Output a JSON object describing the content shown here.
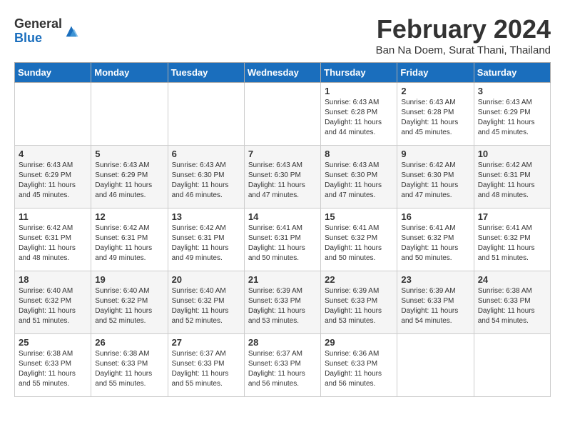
{
  "logo": {
    "general": "General",
    "blue": "Blue"
  },
  "header": {
    "month": "February 2024",
    "location": "Ban Na Doem, Surat Thani, Thailand"
  },
  "weekdays": [
    "Sunday",
    "Monday",
    "Tuesday",
    "Wednesday",
    "Thursday",
    "Friday",
    "Saturday"
  ],
  "weeks": [
    [
      {
        "day": "",
        "info": ""
      },
      {
        "day": "",
        "info": ""
      },
      {
        "day": "",
        "info": ""
      },
      {
        "day": "",
        "info": ""
      },
      {
        "day": "1",
        "info": "Sunrise: 6:43 AM\nSunset: 6:28 PM\nDaylight: 11 hours\nand 44 minutes."
      },
      {
        "day": "2",
        "info": "Sunrise: 6:43 AM\nSunset: 6:28 PM\nDaylight: 11 hours\nand 45 minutes."
      },
      {
        "day": "3",
        "info": "Sunrise: 6:43 AM\nSunset: 6:29 PM\nDaylight: 11 hours\nand 45 minutes."
      }
    ],
    [
      {
        "day": "4",
        "info": "Sunrise: 6:43 AM\nSunset: 6:29 PM\nDaylight: 11 hours\nand 45 minutes."
      },
      {
        "day": "5",
        "info": "Sunrise: 6:43 AM\nSunset: 6:29 PM\nDaylight: 11 hours\nand 46 minutes."
      },
      {
        "day": "6",
        "info": "Sunrise: 6:43 AM\nSunset: 6:30 PM\nDaylight: 11 hours\nand 46 minutes."
      },
      {
        "day": "7",
        "info": "Sunrise: 6:43 AM\nSunset: 6:30 PM\nDaylight: 11 hours\nand 47 minutes."
      },
      {
        "day": "8",
        "info": "Sunrise: 6:43 AM\nSunset: 6:30 PM\nDaylight: 11 hours\nand 47 minutes."
      },
      {
        "day": "9",
        "info": "Sunrise: 6:42 AM\nSunset: 6:30 PM\nDaylight: 11 hours\nand 47 minutes."
      },
      {
        "day": "10",
        "info": "Sunrise: 6:42 AM\nSunset: 6:31 PM\nDaylight: 11 hours\nand 48 minutes."
      }
    ],
    [
      {
        "day": "11",
        "info": "Sunrise: 6:42 AM\nSunset: 6:31 PM\nDaylight: 11 hours\nand 48 minutes."
      },
      {
        "day": "12",
        "info": "Sunrise: 6:42 AM\nSunset: 6:31 PM\nDaylight: 11 hours\nand 49 minutes."
      },
      {
        "day": "13",
        "info": "Sunrise: 6:42 AM\nSunset: 6:31 PM\nDaylight: 11 hours\nand 49 minutes."
      },
      {
        "day": "14",
        "info": "Sunrise: 6:41 AM\nSunset: 6:31 PM\nDaylight: 11 hours\nand 50 minutes."
      },
      {
        "day": "15",
        "info": "Sunrise: 6:41 AM\nSunset: 6:32 PM\nDaylight: 11 hours\nand 50 minutes."
      },
      {
        "day": "16",
        "info": "Sunrise: 6:41 AM\nSunset: 6:32 PM\nDaylight: 11 hours\nand 50 minutes."
      },
      {
        "day": "17",
        "info": "Sunrise: 6:41 AM\nSunset: 6:32 PM\nDaylight: 11 hours\nand 51 minutes."
      }
    ],
    [
      {
        "day": "18",
        "info": "Sunrise: 6:40 AM\nSunset: 6:32 PM\nDaylight: 11 hours\nand 51 minutes."
      },
      {
        "day": "19",
        "info": "Sunrise: 6:40 AM\nSunset: 6:32 PM\nDaylight: 11 hours\nand 52 minutes."
      },
      {
        "day": "20",
        "info": "Sunrise: 6:40 AM\nSunset: 6:32 PM\nDaylight: 11 hours\nand 52 minutes."
      },
      {
        "day": "21",
        "info": "Sunrise: 6:39 AM\nSunset: 6:33 PM\nDaylight: 11 hours\nand 53 minutes."
      },
      {
        "day": "22",
        "info": "Sunrise: 6:39 AM\nSunset: 6:33 PM\nDaylight: 11 hours\nand 53 minutes."
      },
      {
        "day": "23",
        "info": "Sunrise: 6:39 AM\nSunset: 6:33 PM\nDaylight: 11 hours\nand 54 minutes."
      },
      {
        "day": "24",
        "info": "Sunrise: 6:38 AM\nSunset: 6:33 PM\nDaylight: 11 hours\nand 54 minutes."
      }
    ],
    [
      {
        "day": "25",
        "info": "Sunrise: 6:38 AM\nSunset: 6:33 PM\nDaylight: 11 hours\nand 55 minutes."
      },
      {
        "day": "26",
        "info": "Sunrise: 6:38 AM\nSunset: 6:33 PM\nDaylight: 11 hours\nand 55 minutes."
      },
      {
        "day": "27",
        "info": "Sunrise: 6:37 AM\nSunset: 6:33 PM\nDaylight: 11 hours\nand 55 minutes."
      },
      {
        "day": "28",
        "info": "Sunrise: 6:37 AM\nSunset: 6:33 PM\nDaylight: 11 hours\nand 56 minutes."
      },
      {
        "day": "29",
        "info": "Sunrise: 6:36 AM\nSunset: 6:33 PM\nDaylight: 11 hours\nand 56 minutes."
      },
      {
        "day": "",
        "info": ""
      },
      {
        "day": "",
        "info": ""
      }
    ]
  ]
}
